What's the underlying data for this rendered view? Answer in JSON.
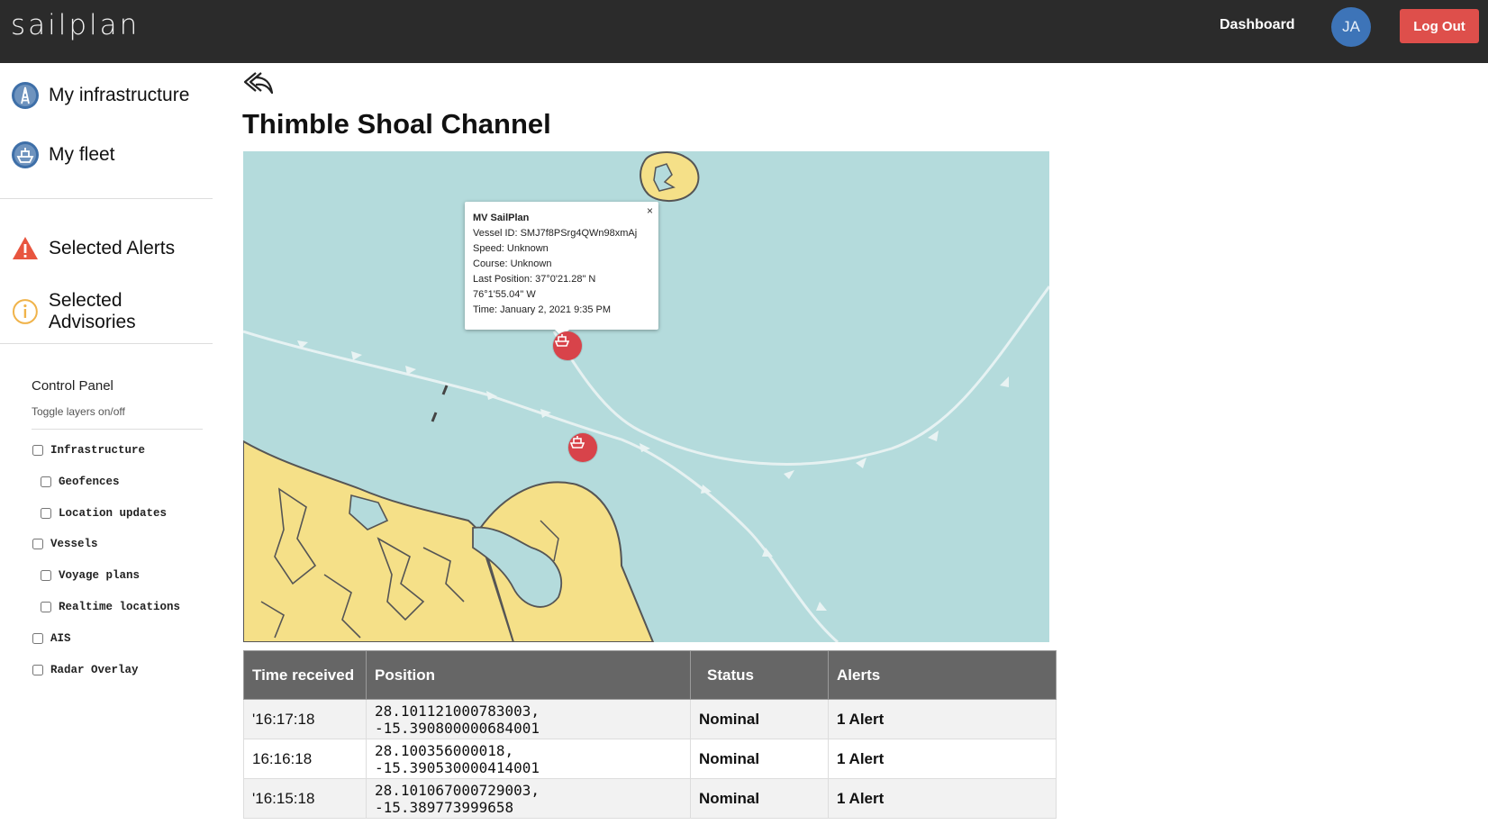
{
  "header": {
    "logo": "sailplan",
    "dashboard_label": "Dashboard",
    "avatar_initials": "JA",
    "logout_label": "Log Out"
  },
  "sidebar": {
    "items": [
      {
        "label": "My infrastructure",
        "icon": "oil-rig-icon"
      },
      {
        "label": "My fleet",
        "icon": "ship-icon"
      },
      {
        "label": "Selected Alerts",
        "icon": "warning-icon"
      },
      {
        "label": "Selected Advisories",
        "icon": "info-icon"
      }
    ],
    "control_panel": {
      "title": "Control Panel",
      "subtitle": "Toggle layers on/off",
      "layers": [
        {
          "label": "Infrastructure",
          "checked": false
        },
        {
          "label": "Geofences",
          "checked": false
        },
        {
          "label": "Location updates",
          "checked": false
        },
        {
          "label": "Vessels",
          "checked": false
        },
        {
          "label": "Voyage plans",
          "checked": false
        },
        {
          "label": "Realtime locations",
          "checked": false
        },
        {
          "label": "AIS",
          "checked": false
        },
        {
          "label": "Radar Overlay",
          "checked": false
        }
      ]
    }
  },
  "main": {
    "title": "Thimble Shoal Channel",
    "popup": {
      "name": "MV SailPlan",
      "vessel_id": "Vessel ID: SMJ7f8PSrg4QWn98xmAj",
      "speed": "Speed: Unknown",
      "course": "Course: Unknown",
      "last_position": "Last Position: 37°0'21.28\" N",
      "last_position_lon": "76°1'55.04\" W",
      "time": "Time: January 2, 2021 9:35 PM",
      "close": "×"
    },
    "table": {
      "headers": [
        "Time received",
        "Position",
        "Status",
        "Alerts"
      ],
      "rows": [
        {
          "time": "'16:17:18",
          "position": "28.101121000783003, -15.390800000684001",
          "status": "Nominal",
          "alerts": "1 Alert"
        },
        {
          "time": "16:16:18",
          "position": "28.100356000018, -15.390530000414001",
          "status": "Nominal",
          "alerts": "1 Alert"
        },
        {
          "time": "'16:15:18",
          "position": "28.101067000729003, -15.389773999658",
          "status": "Nominal",
          "alerts": "1 Alert"
        }
      ]
    }
  },
  "colors": {
    "topbar": "#2b2b2b",
    "logout": "#de4f4b",
    "avatar": "#3d74b8",
    "water": "#b4dbdc",
    "land": "#f5e088",
    "marker": "#d8434a",
    "table_header": "#666666"
  }
}
